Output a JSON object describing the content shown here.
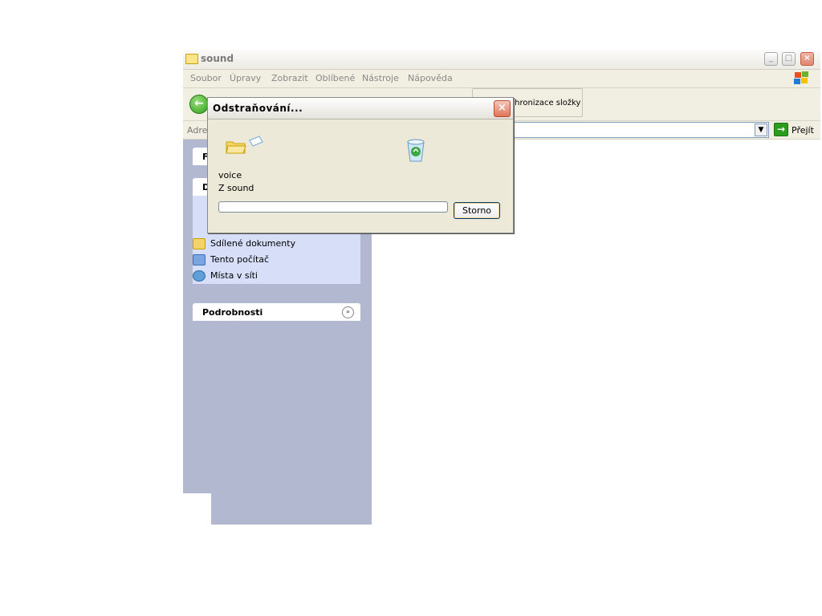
{
  "window": {
    "title": "sound",
    "menu": [
      "Soubor",
      "Úpravy",
      "Zobrazit",
      "Oblíbené",
      "Nástroje",
      "Nápověda"
    ],
    "toolbar": {
      "sync_label": "Synchronizace složky"
    },
    "address": {
      "label": "Adresa",
      "go_label": "Přejít"
    }
  },
  "sidebar": {
    "section_top_label": "F",
    "section_places_label": "D",
    "items": [
      {
        "label": "Sdílené dokumenty",
        "icon": "folder-icon"
      },
      {
        "label": "Tento počítač",
        "icon": "computer-icon"
      },
      {
        "label": "Místa v síti",
        "icon": "network-icon"
      }
    ],
    "details_label": "Podrobnosti"
  },
  "dialog": {
    "title": "Odstraňování...",
    "file_name": "voice",
    "from_text": "Z sound",
    "cancel_label": "Storno",
    "progress": 0
  },
  "colors": {
    "window_close": "#e0745a",
    "sidebar_bg": "#aab0cf",
    "go_green": "#2d9b1c"
  }
}
